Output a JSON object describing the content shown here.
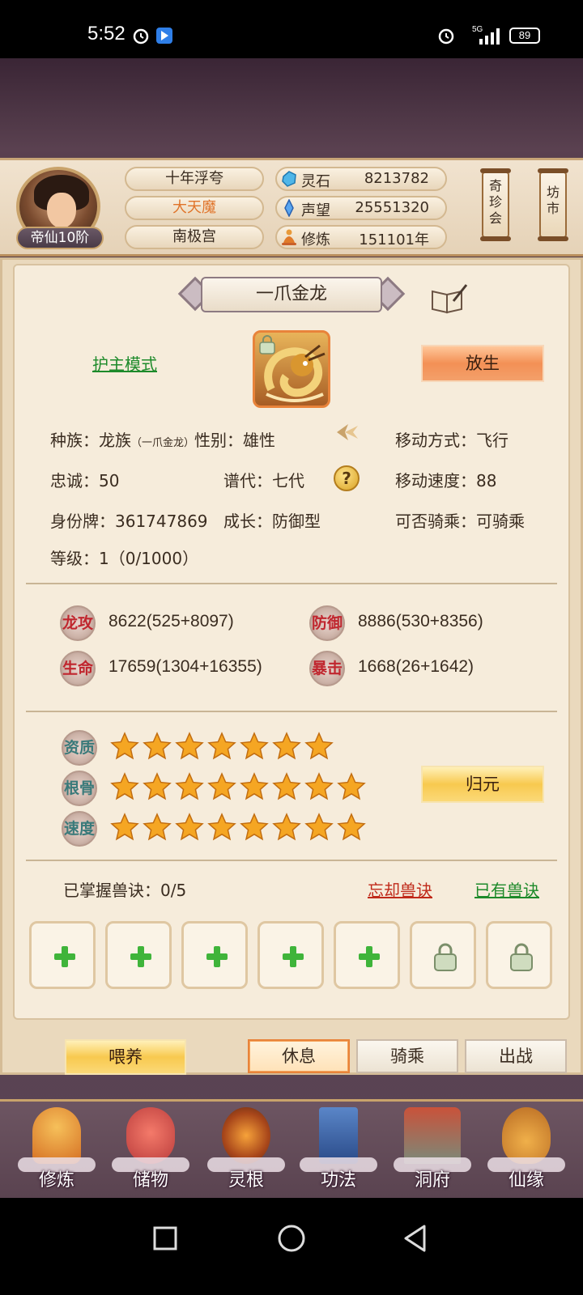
{
  "status_bar": {
    "time": "5:52",
    "battery": "89",
    "network": "5G"
  },
  "header": {
    "rank": "帝仙10阶",
    "tags": [
      "十年浮夸",
      "大天魔",
      "南极宫"
    ],
    "resources": [
      {
        "label": "灵石",
        "value": "8213782",
        "icon": "spirit-stone-icon"
      },
      {
        "label": "声望",
        "value": "25551320",
        "icon": "prestige-crystal-icon"
      },
      {
        "label": "修炼",
        "value": "151101年",
        "icon": "meditation-icon"
      }
    ],
    "side_buttons": [
      "奇珍会",
      "坊市"
    ]
  },
  "pet": {
    "name": "一爪金龙",
    "mode_link": "护主模式",
    "release_label": "放生",
    "attributes": {
      "race_label": "种族：",
      "race_value": "龙族",
      "race_sub": "（一爪金龙）",
      "gender_label": "性别：",
      "gender_value": "雄性",
      "move_type_label": "移动方式：",
      "move_type_value": "飞行",
      "loyalty_label": "忠诚：",
      "loyalty_value": "50",
      "generation_label": "谱代：",
      "generation_value": "七代",
      "move_speed_label": "移动速度：",
      "move_speed_value": "88",
      "id_label": "身份牌：",
      "id_value": "361747869",
      "growth_label": "成长：",
      "growth_value": "防御型",
      "rideable_label": "可否骑乘：",
      "rideable_value": "可骑乘",
      "level_label": "等级：",
      "level_value": "1（0/1000）"
    },
    "stats": [
      {
        "icon_text": "龙攻",
        "value": "8622(525+8097)"
      },
      {
        "icon_text": "防御",
        "value": "8886(530+8356)"
      },
      {
        "icon_text": "生命",
        "value": "17659(1304+16355)"
      },
      {
        "icon_text": "暴击",
        "value": "1668(26+1642)"
      }
    ],
    "ratings": [
      {
        "label": "资质",
        "stars": 7
      },
      {
        "label": "根骨",
        "stars": 8
      },
      {
        "label": "速度",
        "stars": 8
      }
    ],
    "restore_label": "归元",
    "skills": {
      "mastered_label": "已掌握兽诀：0/5",
      "forget_link": "忘却兽诀",
      "owned_link": "已有兽诀",
      "slots": [
        "add",
        "add",
        "add",
        "add",
        "add",
        "locked",
        "locked"
      ]
    }
  },
  "actions": {
    "feed": "喂养",
    "tabs": [
      "休息",
      "骑乘",
      "出战"
    ],
    "active_tab": "休息"
  },
  "bottom_nav": [
    "修炼",
    "储物",
    "灵根",
    "功法",
    "洞府",
    "仙缘"
  ],
  "colors": {
    "accent_orange": "#f39055",
    "accent_yellow": "#f8c94f",
    "link_green": "#1d8a2a",
    "link_red": "#c02a1a",
    "star": "#f5a623"
  }
}
